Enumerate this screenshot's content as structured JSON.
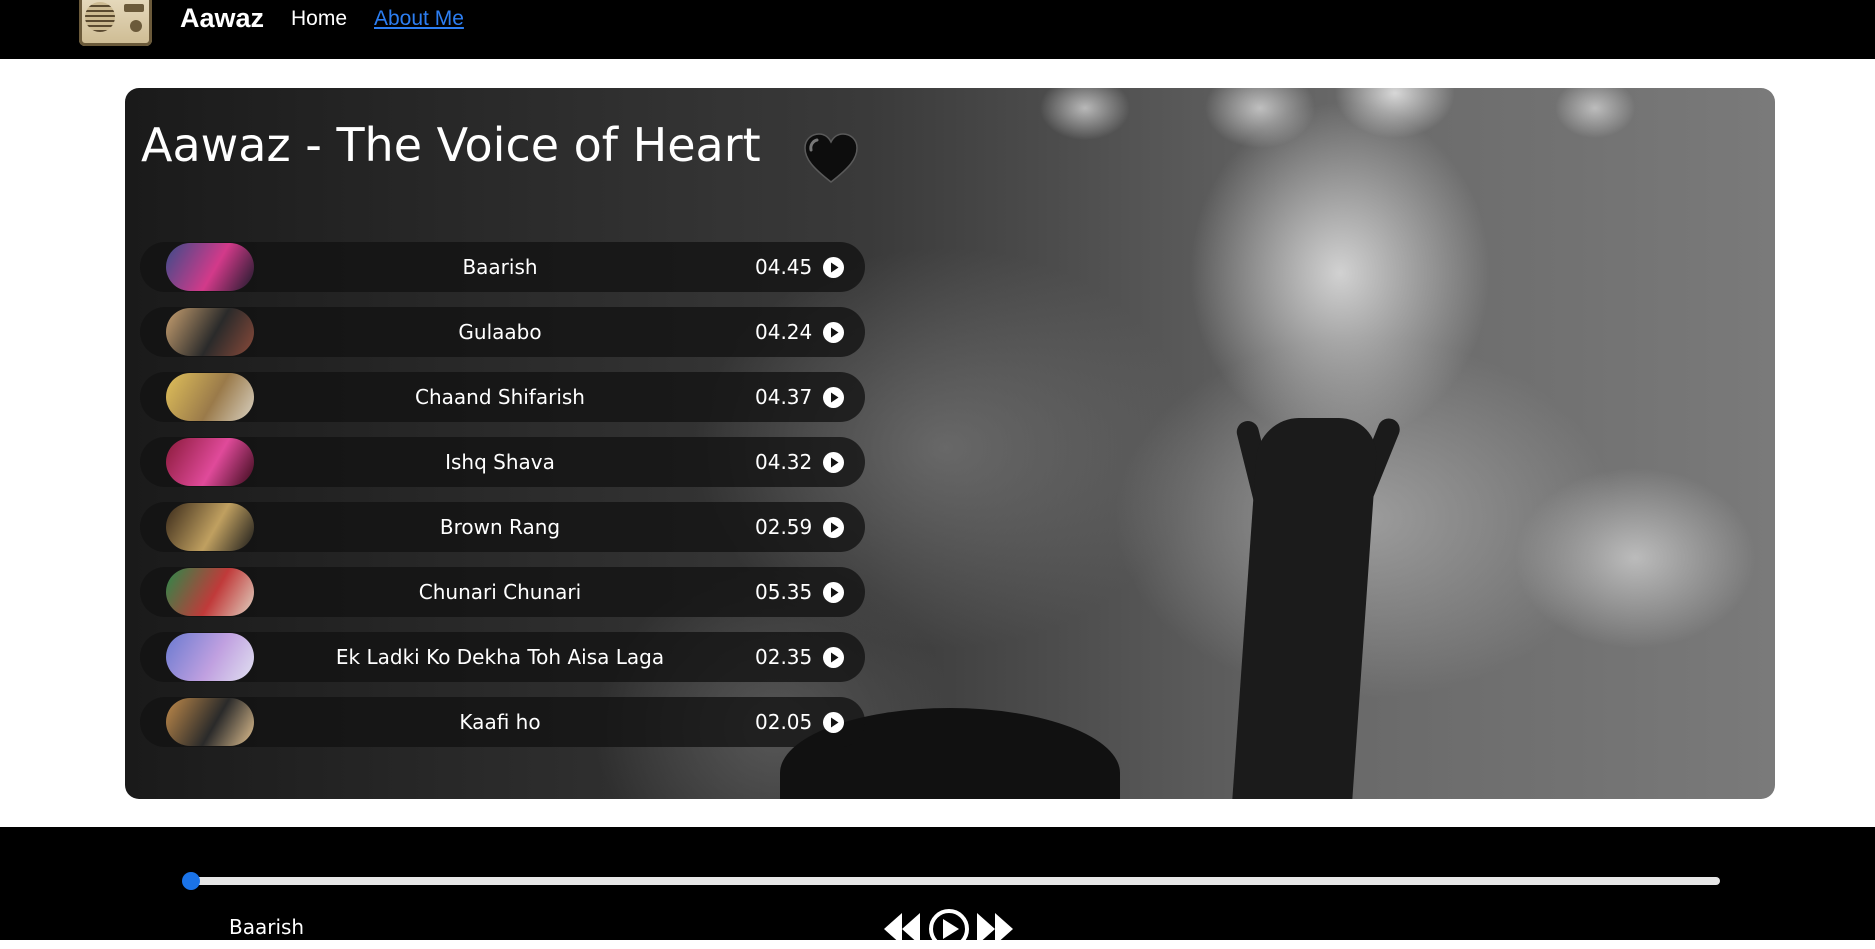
{
  "nav": {
    "brand": "Aawaz",
    "home": "Home",
    "about": "About Me",
    "logo_icon": "radio-icon"
  },
  "hero": {
    "title": "Aawaz - The Voice of Heart",
    "heart_icon": "black-heart-icon"
  },
  "songs": [
    {
      "name": "Baarish",
      "duration": "04.45",
      "cover": [
        "#3a4c8a",
        "#d33a8a",
        "#1a1a2a"
      ]
    },
    {
      "name": "Gulaabo",
      "duration": "04.24",
      "cover": [
        "#c8a070",
        "#2a2a2a",
        "#8a4a3a"
      ]
    },
    {
      "name": "Chaand Shifarish",
      "duration": "04.37",
      "cover": [
        "#e0c05a",
        "#9a7a4a",
        "#d8d0c0"
      ]
    },
    {
      "name": "Ishq Shava",
      "duration": "04.32",
      "cover": [
        "#8a1a3a",
        "#e04a9a",
        "#3a0a1a"
      ]
    },
    {
      "name": "Brown Rang",
      "duration": "02.59",
      "cover": [
        "#3a2a1a",
        "#c0a060",
        "#1a1a1a"
      ]
    },
    {
      "name": "Chunari Chunari",
      "duration": "05.35",
      "cover": [
        "#2a8a4a",
        "#c03a3a",
        "#e0d0c0"
      ]
    },
    {
      "name": "Ek Ladki Ko Dekha Toh Aisa Laga",
      "duration": "02.35",
      "cover": [
        "#6a7ad0",
        "#c0a0e0",
        "#e0e0f0"
      ]
    },
    {
      "name": "Kaafi ho",
      "duration": "02.05",
      "cover": [
        "#c08a4a",
        "#2a2a2a",
        "#e0c090"
      ]
    }
  ],
  "player": {
    "now_playing": "Baarish",
    "progress": 0.0,
    "controls": [
      "previous-icon",
      "play-icon",
      "next-icon"
    ]
  }
}
